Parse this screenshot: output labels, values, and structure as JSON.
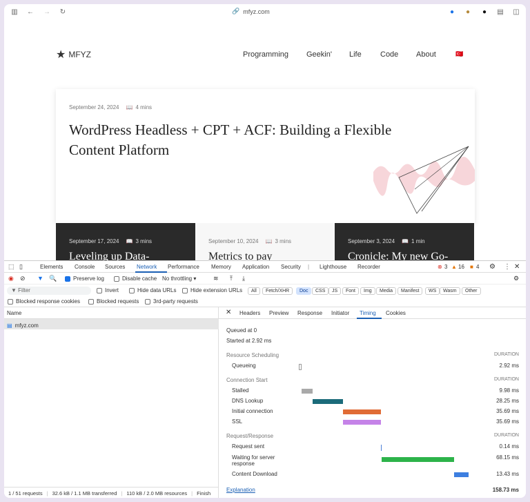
{
  "browser": {
    "url": "mfyz.com"
  },
  "site": {
    "logo": "MFYZ",
    "nav": [
      "Programming",
      "Geekin'",
      "Life",
      "Code",
      "About"
    ],
    "flag": "🇹🇷",
    "featured": {
      "date": "September 24, 2024",
      "read": "4 mins",
      "title": "WordPress Headless + CPT + ACF: Building a Flexible Content Platform"
    },
    "posts": [
      {
        "date": "September 17, 2024",
        "read": "3 mins",
        "title": "Leveling up Data-"
      },
      {
        "date": "September 10, 2024",
        "read": "3 mins",
        "title": "Metrics to pay"
      },
      {
        "date": "September 3, 2024",
        "read": "1 min",
        "title": "Cronicle: My new Go-"
      }
    ]
  },
  "devtools": {
    "tabs": [
      "Elements",
      "Console",
      "Sources",
      "Network",
      "Performance",
      "Memory",
      "Application",
      "Security",
      "Lighthouse",
      "Recorder"
    ],
    "active_tab": "Network",
    "errors": "3",
    "warnings": "16",
    "issues": "4",
    "toolbar": {
      "preserve_log": "Preserve log",
      "disable_cache": "Disable cache",
      "throttling": "No throttling"
    },
    "filter": {
      "placeholder": "Filter",
      "invert": "Invert",
      "hide_data": "Hide data URLs",
      "hide_ext": "Hide extension URLs"
    },
    "types": [
      "All",
      "Fetch/XHR",
      "Doc",
      "CSS",
      "JS",
      "Font",
      "Img",
      "Media",
      "Manifest",
      "WS",
      "Wasm",
      "Other"
    ],
    "active_type": "Doc",
    "blocked": {
      "response_cookies": "Blocked response cookies",
      "requests": "Blocked requests",
      "third_party": "3rd-party requests"
    },
    "list": {
      "header": "Name",
      "request": "mfyz.com"
    },
    "status": {
      "requests": "1 / 51 requests",
      "transferred": "32.6 kB / 1.1 MB transferred",
      "resources": "110 kB / 2.0 MB resources",
      "finish": "Finish"
    },
    "detail_tabs": [
      "Headers",
      "Preview",
      "Response",
      "Initiator",
      "Timing",
      "Cookies"
    ],
    "active_detail": "Timing",
    "timing": {
      "queued": "Queued at 0",
      "started": "Started at 2.92 ms",
      "duration_label": "DURATION",
      "sections": [
        {
          "title": "Resource Scheduling",
          "rows": [
            {
              "label": "Queueing",
              "value": "2.92 ms",
              "start": 0.0,
              "end": 0.018,
              "color": "#ffffff"
            }
          ]
        },
        {
          "title": "Connection Start",
          "rows": [
            {
              "label": "Stalled",
              "value": "9.98 ms",
              "start": 0.018,
              "end": 0.081,
              "color": "#a9a9a9"
            },
            {
              "label": "DNS Lookup",
              "value": "28.25 ms",
              "start": 0.081,
              "end": 0.259,
              "color": "#1b6b7a"
            },
            {
              "label": "Initial connection",
              "value": "35.69 ms",
              "start": 0.259,
              "end": 0.484,
              "color": "#e06c36"
            },
            {
              "label": "SSL",
              "value": "35.69 ms",
              "start": 0.259,
              "end": 0.484,
              "color": "#c583e8"
            }
          ]
        },
        {
          "title": "Request/Response",
          "rows": [
            {
              "label": "Request sent",
              "value": "0.14 ms",
              "start": 0.484,
              "end": 0.486,
              "color": "#4a7fd6"
            },
            {
              "label": "Waiting for server response",
              "value": "68.15 ms",
              "start": 0.486,
              "end": 0.915,
              "color": "#2db34a"
            },
            {
              "label": "Content Download",
              "value": "13.43 ms",
              "start": 0.915,
              "end": 1.0,
              "color": "#3d7fe0"
            }
          ]
        }
      ],
      "explanation": "Explanation",
      "total": "158.73 ms"
    }
  }
}
